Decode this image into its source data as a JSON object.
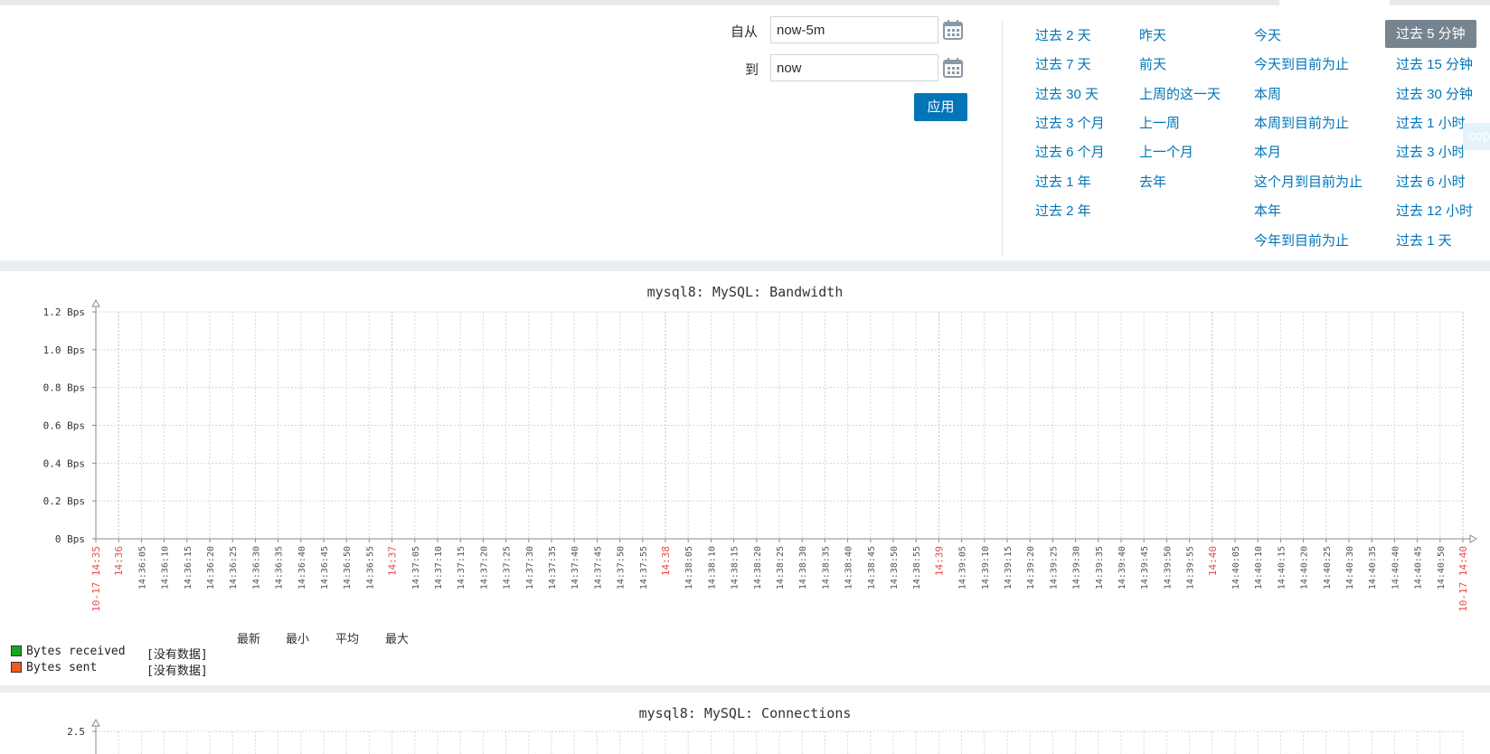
{
  "filter": {
    "from_label": "自从",
    "from_value": "now-5m",
    "to_label": "到",
    "to_value": "now",
    "apply_label": "应用",
    "quick_links": [
      [
        "过去 2 天",
        "过去 7 天",
        "过去 30 天",
        "过去 3 个月",
        "过去 6 个月",
        "过去 1 年",
        "过去 2 年"
      ],
      [
        "昨天",
        "前天",
        "上周的这一天",
        "上一周",
        "上一个月",
        "去年"
      ],
      [
        "今天",
        "今天到目前为止",
        "本周",
        "本周到目前为止",
        "本月",
        "这个月到目前为止",
        "本年",
        "今年到目前为止"
      ],
      [
        "过去 5 分钟",
        "过去 15 分钟",
        "过去 30 分钟",
        "过去 1 小时",
        "过去 3 小时",
        "过去 6 小时",
        "过去 12 小时",
        "过去 1 天"
      ]
    ],
    "selected": "过去 5 分钟",
    "copy_badge": "cop"
  },
  "graphs": [
    {
      "title": "mysql8: MySQL: Bandwidth",
      "legend_headers": [
        "最新",
        "最小",
        "平均",
        "最大"
      ],
      "legend": [
        {
          "name": "Bytes received",
          "color": "#1ea51e",
          "value": "[没有数据]"
        },
        {
          "name": "Bytes sent",
          "color": "#f25a22",
          "value": "[没有数据]"
        }
      ]
    },
    {
      "title": "mysql8: MySQL: Connections"
    }
  ],
  "chart_data": [
    {
      "type": "line",
      "title": "mysql8: MySQL: Bandwidth",
      "y_ticks": [
        "0 Bps",
        "0.2 Bps",
        "0.4 Bps",
        "0.6 Bps",
        "0.8 Bps",
        "1.0 Bps",
        "1.2 Bps"
      ],
      "ylim": [
        0,
        1.2
      ],
      "x_tick_labels": [
        "10-17 14:35",
        "14:36",
        "14:36:05",
        "14:36:10",
        "14:36:15",
        "14:36:20",
        "14:36:25",
        "14:36:30",
        "14:36:35",
        "14:36:40",
        "14:36:45",
        "14:36:50",
        "14:36:55",
        "14:37",
        "14:37:05",
        "14:37:10",
        "14:37:15",
        "14:37:20",
        "14:37:25",
        "14:37:30",
        "14:37:35",
        "14:37:40",
        "14:37:45",
        "14:37:50",
        "14:37:55",
        "14:38",
        "14:38:05",
        "14:38:10",
        "14:38:15",
        "14:38:20",
        "14:38:25",
        "14:38:30",
        "14:38:35",
        "14:38:40",
        "14:38:45",
        "14:38:50",
        "14:38:55",
        "14:39",
        "14:39:05",
        "14:39:10",
        "14:39:15",
        "14:39:20",
        "14:39:25",
        "14:39:30",
        "14:39:35",
        "14:39:40",
        "14:39:45",
        "14:39:50",
        "14:39:55",
        "14:40",
        "14:40:05",
        "14:40:10",
        "14:40:15",
        "14:40:20",
        "14:40:25",
        "14:40:30",
        "14:40:35",
        "14:40:40",
        "14:40:45",
        "14:40:50",
        "10-17 14:40"
      ],
      "highlight_ticks": [
        "10-17 14:35",
        "14:36",
        "14:37",
        "14:38",
        "14:39",
        "14:40",
        "10-17 14:40"
      ],
      "highlight_color": "#e84a4a",
      "grid": true,
      "series": [
        {
          "name": "Bytes received",
          "values": []
        },
        {
          "name": "Bytes sent",
          "values": []
        }
      ]
    },
    {
      "type": "line",
      "title": "mysql8: MySQL: Connections",
      "y_ticks": [
        "2.5"
      ],
      "grid": true,
      "series": []
    }
  ]
}
